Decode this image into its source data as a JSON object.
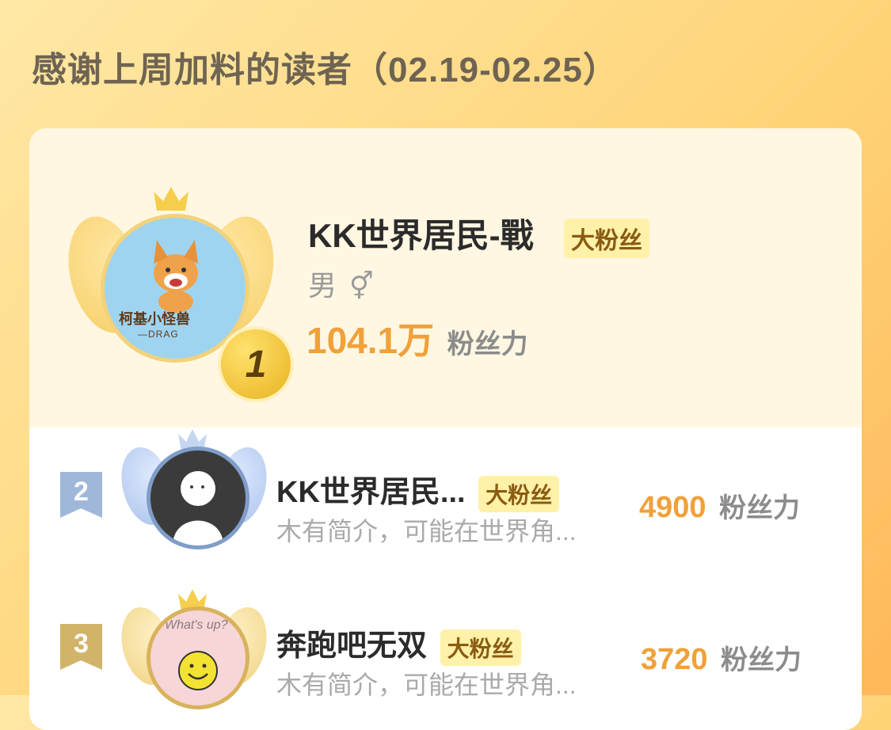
{
  "header": {
    "title": "感谢上周加料的读者（02.19-02.25）"
  },
  "ranking": [
    {
      "rank": "1",
      "name": "KK世界居民-戰",
      "badge": "大粉丝",
      "gender": "男",
      "gender_icon": "⚥",
      "score": "104.1万",
      "score_unit": "粉丝力",
      "avatar_label": "柯基小怪兽",
      "avatar_sub": "—DRAG",
      "medal_color": "#e8b21f"
    },
    {
      "rank": "2",
      "name": "KK世界居民...",
      "badge": "大粉丝",
      "desc": "木有简介，可能在世界角...",
      "score": "4900",
      "score_unit": "粉丝力",
      "ribbon_color": "#9fb7d8"
    },
    {
      "rank": "3",
      "name": "奔跑吧无双",
      "badge": "大粉丝",
      "desc": "木有简介，可能在世界角...",
      "score": "3720",
      "score_unit": "粉丝力",
      "avatar_label": "What's up?",
      "ribbon_color": "#d1b469"
    }
  ]
}
